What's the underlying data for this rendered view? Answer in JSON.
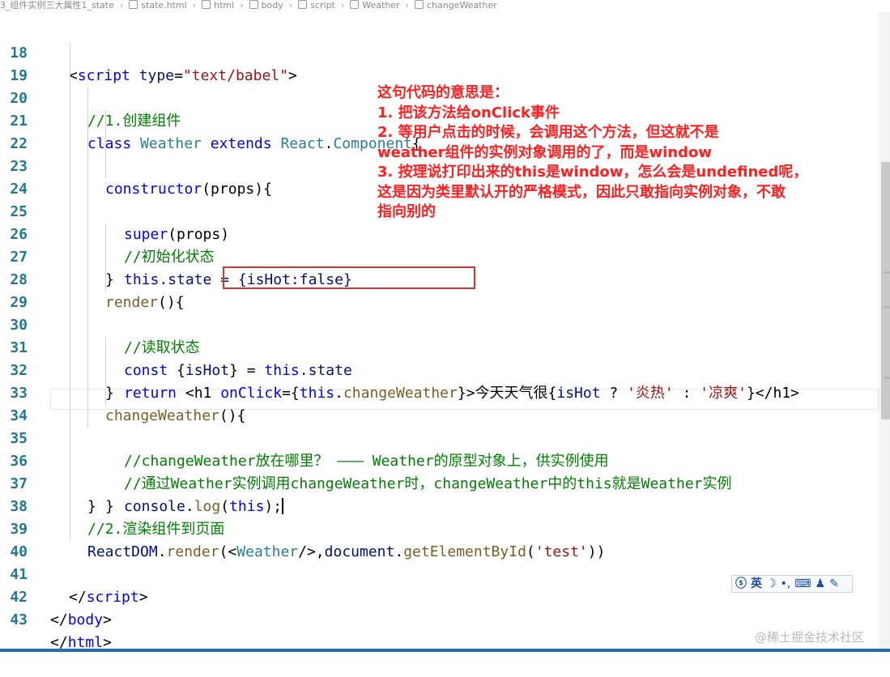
{
  "breadcrumb": [
    "3_组件实例三大属性1_state",
    "state.html",
    "html",
    "body",
    "script",
    "Weather",
    "changeWeather"
  ],
  "line_numbers": [
    "18",
    "19",
    "20",
    "21",
    "22",
    "23",
    "24",
    "25",
    "26",
    "27",
    "28",
    "29",
    "30",
    "31",
    "32",
    "33",
    "34",
    "35",
    "36",
    "37",
    "38",
    "39",
    "40",
    "41",
    "42",
    "43"
  ],
  "code": {
    "l18": {
      "lt": "<",
      "tag": "script",
      "attr": "type",
      "eq": "=",
      "val": "\"text/babel\"",
      "gt": ">"
    },
    "l19": "//1.创建组件",
    "l20": {
      "k1": "class",
      "name": "Weather",
      "k2": "extends",
      "base": "React",
      "dot": ".",
      "comp": "Component",
      "brace": "{"
    },
    "l21": {
      "fn": "constructor",
      "rest": "(props){"
    },
    "l22": {
      "fn": "super",
      "rest": "(props)"
    },
    "l23": "//初始化状态",
    "l24": {
      "kw": "this",
      "rest": ".state = {isHot:false}"
    },
    "l25": "}",
    "l26": {
      "fn": "render",
      "rest": "(){"
    },
    "l27": "//读取状态",
    "l28": {
      "kw": "const",
      "open": " {",
      "var": "isHot",
      "mid": "} = ",
      "kw2": "this",
      "rest": ".state"
    },
    "l29": {
      "ret": "return",
      "h1": " <h1 ",
      "onclick": "onClick",
      "eq": "={",
      "kw": "this",
      "dot": ".",
      "method": "changeWeather",
      "close": "}>今天天气很{",
      "var": "isHot",
      "q": " ? ",
      "s1": "'炎热'",
      "colon": " : ",
      "s2": "'凉爽'",
      "end": "}</h1>"
    },
    "l30": "}",
    "l31": {
      "fn": "changeWeather",
      "rest": "(){"
    },
    "l32": "//changeWeather放在哪里？ ——— Weather的原型对象上，供实例使用",
    "l33": "//通过Weather实例调用changeWeather时，changeWeather中的this就是Weather实例",
    "l34": {
      "obj": "console",
      "dot": ".",
      "fn": "log",
      "open": "(",
      "kw": "this",
      "close": ");"
    },
    "l35": "}",
    "l36": "}",
    "l37": "//2.渲染组件到页面",
    "l38": {
      "obj": "ReactDOM",
      "dot": ".",
      "fn": "render",
      "open": "(<",
      "comp": "Weather",
      "mid": "/>,",
      "doc": "document",
      "dot2": ".",
      "fn2": "getElementById",
      "open2": "(",
      "str": "'test'",
      "close": "))"
    },
    "l41": {
      "lt": "</",
      "tag": "script",
      "gt": ">"
    },
    "l42": {
      "lt": "</",
      "tag": "body",
      "gt": ">"
    },
    "l43": {
      "lt": "</",
      "tag": "html",
      "gt": ">"
    }
  },
  "annotation": [
    "这句代码的意思是：",
    "1. 把该方法给onClick事件",
    "2. 等用户点击的时候，会调用这个方法，但这就不是",
    "weather组件的实例对象调用的了，而是window",
    "3. 按理说打印出来的this是window，怎么会是undefined呢，",
    "这是因为类里默认开的严格模式，因此只敢指向实例对象，不敢",
    "指向别的"
  ],
  "ime": {
    "mode": "英",
    "items": [
      "☽",
      "•,",
      "⌨",
      "♟",
      "✎"
    ]
  },
  "watermark": "@稀土掘金技术社区",
  "colors": {
    "keyword": "#0000ff",
    "string": "#a31515",
    "comment": "#008000",
    "annotation": "#ff1f1f",
    "highlight_box": "#e03030"
  }
}
